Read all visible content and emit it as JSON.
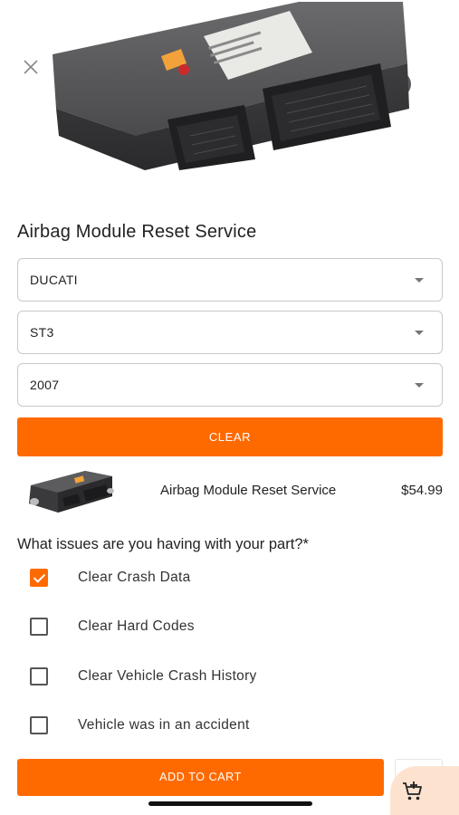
{
  "page": {
    "title": "Airbag Module Reset Service"
  },
  "hero": {
    "image": "airbag-module-photo",
    "close_icon": "close-icon"
  },
  "selects": [
    {
      "value": "DUCATI",
      "icon": "chevron-down-icon"
    },
    {
      "value": "ST3",
      "icon": "chevron-down-icon"
    },
    {
      "value": "2007",
      "icon": "chevron-down-icon"
    }
  ],
  "clear_button": {
    "label": "CLEAR"
  },
  "product": {
    "name": "Airbag Module Reset Service",
    "price": "$54.99"
  },
  "issues": {
    "question": "What issues are you having with your part?*",
    "options": [
      {
        "label": "Clear Crash Data",
        "checked": true
      },
      {
        "label": "Clear Hard Codes",
        "checked": false
      },
      {
        "label": "Clear Vehicle Crash History",
        "checked": false
      },
      {
        "label": "Vehicle was in an accident",
        "checked": false
      }
    ]
  },
  "cart": {
    "add_label": "ADD TO CART",
    "fab_icon": "cart-plus-icon"
  },
  "colors": {
    "accent": "#ff6a00",
    "fab_bg": "#fde2cf"
  }
}
